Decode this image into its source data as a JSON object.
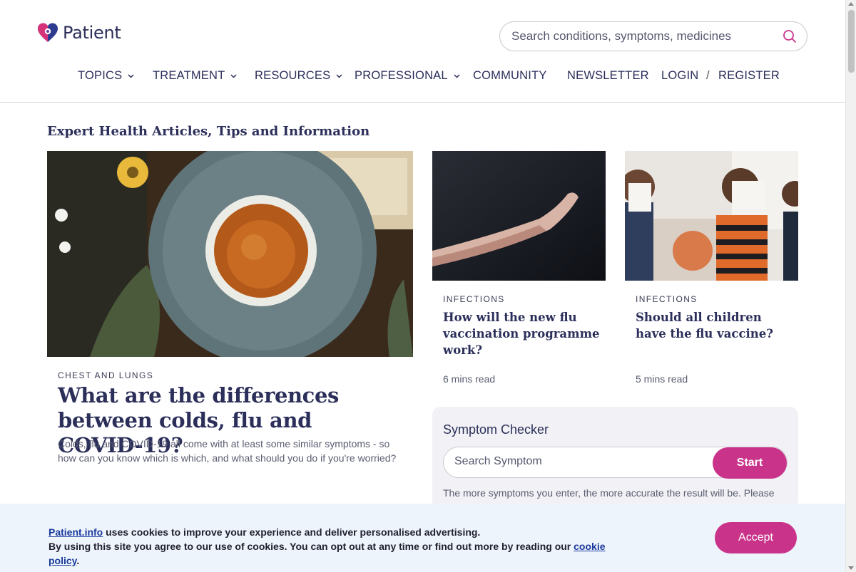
{
  "brand": {
    "name": "Patient",
    "accent": "#c9338a",
    "navy": "#2b2f5a"
  },
  "search": {
    "placeholder": "Search conditions, symptoms, medicines",
    "icon": "search-icon"
  },
  "nav": {
    "topics": "TOPICS",
    "treatment": "TREATMENT",
    "resources": "RESOURCES",
    "professional": "PROFESSIONAL",
    "community": "COMMUNITY",
    "newsletter": "NEWSLETTER",
    "login": "LOGIN",
    "separator": "/",
    "register": "REGISTER"
  },
  "main": {
    "section_title": "Expert Health Articles, Tips and Information",
    "hero": {
      "category": "CHEST AND LUNGS",
      "title": "What are the differences between colds, flu and COVID-19?",
      "description": "Colds, flu and COVID-19 all come with at least some similar symptoms - so how can you know which is which, and what should you do if you're worried?"
    },
    "cards": [
      {
        "category": "INFECTIONS",
        "title": "How will the new flu vaccination programme work?",
        "read_time": "6 mins read"
      },
      {
        "category": "INFECTIONS",
        "title": "Should all children have the flu vaccine?",
        "read_time": "5 mins read"
      }
    ],
    "symptom_checker": {
      "title": "Symptom Checker",
      "placeholder": "Search Symptom",
      "start_label": "Start",
      "note": "The more symptoms you enter, the more accurate the result will be. Please"
    }
  },
  "cookie_banner": {
    "site_link": "Patient.info",
    "line1_rest": " uses cookies to improve your experience and deliver personalised advertising.",
    "line2_start": "By using this site you agree to our use of cookies. You can opt out at any time or find out more by reading our ",
    "policy_link": "cookie policy",
    "line2_end": ".",
    "accept_label": "Accept"
  }
}
